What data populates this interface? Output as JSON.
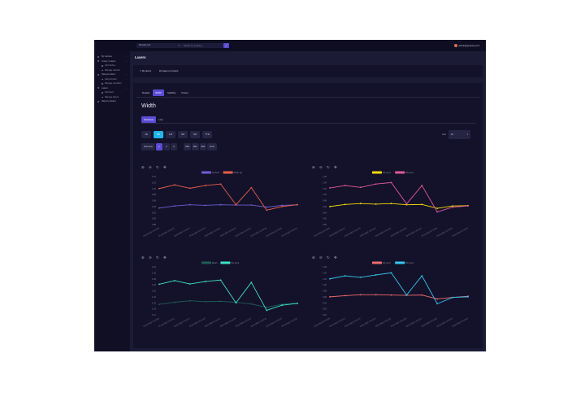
{
  "topbar": {
    "company": "Pentace Ltd.",
    "search_placeholder": "Search for anything",
    "user": "admin@pentace.pl"
  },
  "sidebar": {
    "items": [
      {
        "label": "My devices",
        "level": 0,
        "chevron": false
      },
      {
        "label": "Group / Lasers",
        "level": 0,
        "chevron": true
      },
      {
        "label": "Add device",
        "level": 1,
        "chevron": false
      },
      {
        "label": "Manage devices",
        "level": 1,
        "chevron": false
      },
      {
        "label": "Data providers",
        "level": 0,
        "chevron": true
      },
      {
        "label": "Add provider",
        "level": 1,
        "chevron": false
      },
      {
        "label": "Manage providers",
        "level": 1,
        "chevron": false
      },
      {
        "label": "Lasers",
        "level": 0,
        "chevron": true
      },
      {
        "label": "Add laser",
        "level": 1,
        "chevron": false
      },
      {
        "label": "Manage lasers",
        "level": 1,
        "chevron": false
      },
      {
        "label": "Report problem",
        "level": 0,
        "chevron": false
      }
    ]
  },
  "page": {
    "title": "Lasers",
    "actions": {
      "edit": "✎  My lasers",
      "compare": "⧉  Image to compare"
    }
  },
  "tabs": [
    {
      "label": "Details",
      "active": false
    },
    {
      "label": "Width",
      "active": true
    },
    {
      "label": "Stability",
      "active": false
    },
    {
      "label": "Power",
      "active": false
    }
  ],
  "section_title": "Width",
  "subtabs": [
    {
      "label": "Historical",
      "active": true
    },
    {
      "label": "Live",
      "active": false
    }
  ],
  "ranges": [
    {
      "label": "1D",
      "active": false
    },
    {
      "label": "5D",
      "active": true
    },
    {
      "label": "1M",
      "active": false
    },
    {
      "label": "3M",
      "active": false
    },
    {
      "label": "6M",
      "active": false
    },
    {
      "label": "YTD",
      "active": false
    }
  ],
  "sort": {
    "label": "Sort",
    "value": "10"
  },
  "pager": [
    "Previous",
    "1",
    "2",
    "3",
    "...",
    "800",
    "801",
    "802",
    "Next"
  ],
  "pager_active": "1",
  "chart_icons": [
    "zoom-in-icon",
    "zoom-out-icon",
    "reset-icon",
    "pan-icon"
  ],
  "chart_data": [
    {
      "type": "line",
      "x": [
        "18.03.2022 14:19:09",
        "18.03.2022 14:19:12",
        "18.03.2022 14:19:15",
        "18.03.2022 14:19:18",
        "18.03.2022 14:19:21",
        "18.03.2022 14:19:24",
        "18.03.2022 14:19:27",
        "18.03.2022 14:19:30",
        "18.03.2022 14:19:33",
        "18.03.2022 14:19:36"
      ],
      "yticks": [
        "1.04",
        "1.02",
        "1.00",
        "0.98",
        "0.96",
        "0.94",
        "0.92",
        "0.90",
        "0.88"
      ],
      "ylim": [
        0.88,
        1.04
      ],
      "series": [
        {
          "name": "Amount",
          "color": "#6c5dd3",
          "values": [
            0.935,
            0.942,
            0.946,
            0.944,
            0.946,
            0.945,
            0.945,
            0.938,
            0.944,
            0.946
          ]
        },
        {
          "name": "Mean (μ)",
          "color": "#e85d4a",
          "values": [
            1.0,
            1.012,
            1.001,
            1.01,
            1.015,
            0.946,
            1.003,
            0.928,
            0.94,
            0.946
          ]
        }
      ]
    },
    {
      "type": "line",
      "x": [
        "18.03.2022 14:19:09",
        "18.03.2022 14:19:12",
        "18.03.2022 14:19:15",
        "18.03.2022 14:19:18",
        "18.03.2022 14:19:21",
        "18.03.2022 14:19:24",
        "18.03.2022 14:19:27",
        "18.03.2022 14:19:30",
        "18.03.2022 14:19:33",
        "18.03.2022 14:19:36"
      ],
      "yticks": [
        "1.06",
        "1.04",
        "1.02",
        "1.00",
        "0.98",
        "0.96",
        "0.94",
        "0.92",
        "0.90"
      ],
      "ylim": [
        0.9,
        1.06
      ],
      "series": [
        {
          "name": "Wy (μm)",
          "color": "#f5d90a",
          "values": [
            0.96,
            0.967,
            0.97,
            0.968,
            0.97,
            0.966,
            0.967,
            0.954,
            0.962,
            0.963
          ]
        },
        {
          "name": "Wx (μm)",
          "color": "#e0589a",
          "values": [
            1.022,
            1.03,
            1.024,
            1.035,
            1.04,
            0.969,
            1.03,
            0.942,
            0.958,
            0.962
          ]
        }
      ]
    },
    {
      "type": "line",
      "x": [
        "18.03.2022 14:19:09",
        "18.03.2022 14:19:12",
        "18.03.2022 14:19:15",
        "18.03.2022 14:19:18",
        "18.03.2022 14:19:21",
        "18.03.2022 14:19:24",
        "18.03.2022 14:19:27",
        "18.03.2022 14:19:30",
        "18.03.2022 14:19:33",
        "18.03.2022 14:19:36"
      ],
      "yticks": [
        "1.32",
        "1.30",
        "1.28",
        "1.26",
        "1.24",
        "1.22",
        "1.20",
        "1.18",
        "1.16"
      ],
      "ylim": [
        1.16,
        1.32
      ],
      "series": [
        {
          "name": "Mean",
          "color": "#1e5c58",
          "values": [
            1.195,
            1.202,
            1.207,
            1.204,
            1.205,
            1.202,
            1.196,
            1.185,
            1.195,
            1.199
          ]
        },
        {
          "name": "Wx (μm)",
          "color": "#3ee0c8",
          "values": [
            1.262,
            1.274,
            1.263,
            1.271,
            1.276,
            1.2,
            1.268,
            1.175,
            1.192,
            1.198
          ]
        }
      ]
    },
    {
      "type": "line",
      "x": [
        "18.03.2022 14:19:09",
        "18.03.2022 14:19:12",
        "18.03.2022 14:19:15",
        "18.03.2022 14:19:18",
        "18.03.2022 14:19:21",
        "18.03.2022 14:19:24",
        "18.03.2022 14:19:27",
        "18.03.2022 14:19:30",
        "18.03.2022 14:19:33",
        "18.03.2022 14:19:36"
      ],
      "yticks": [
        "1.06",
        "1.04",
        "1.02",
        "1.00",
        "0.98",
        "0.96",
        "0.94",
        "0.92",
        "0.90"
      ],
      "ylim": [
        0.9,
        1.06
      ],
      "series": [
        {
          "name": "Wy (μm)",
          "color": "#f06a6a",
          "values": [
            0.96,
            0.964,
            0.967,
            0.967,
            0.966,
            0.965,
            0.966,
            0.953,
            0.958,
            0.962
          ]
        },
        {
          "name": "Wx (μm)",
          "color": "#36c6f0",
          "values": [
            1.02,
            1.03,
            1.025,
            1.033,
            1.04,
            0.966,
            1.03,
            0.937,
            0.958,
            0.96
          ]
        }
      ]
    }
  ]
}
